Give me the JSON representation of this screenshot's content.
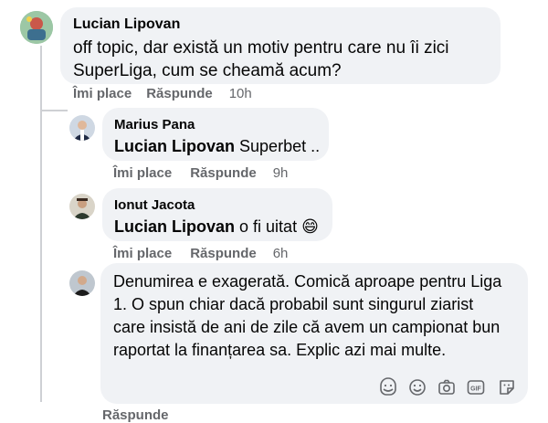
{
  "comments": [
    {
      "author": "Lucian Lipovan",
      "text": "off topic, dar există un motiv pentru care nu îi zici SuperLiga, cum se cheamă acum?",
      "line1": "off topic, dar există un motiv pentru care nu îi zici",
      "line2": "SuperLiga, cum se cheamă acum?",
      "like": "Îmi place",
      "reply": "Răspunde",
      "time": "10h"
    },
    {
      "author": "Marius Pana",
      "mention": "Lucian Lipovan",
      "text": "Superbet ..",
      "like": "Îmi place",
      "reply": "Răspunde",
      "time": "9h"
    },
    {
      "author": "Ionut Jacota",
      "mention": "Lucian Lipovan",
      "text": "o fi uitat 😄",
      "like": "Îmi place",
      "reply": "Răspunde",
      "time": "6h"
    }
  ],
  "reply_box": {
    "lines": [
      "Denumirea e exagerată. Comică aproape pentru Liga",
      "1. O spun chiar dacă probabil sunt singurul ziarist",
      "care insistă de ani de zile că avem un campionat bun",
      "raportat la finanțarea sa. Explic azi mai multe."
    ],
    "tools": [
      "sticker-face-icon",
      "emoji-icon",
      "camera-icon",
      "gif-icon",
      "sticker-icon"
    ],
    "gif_label": "GIF"
  },
  "footer_partial": "Răspunde",
  "colors": {
    "bubble": "#f0f2f5",
    "meta": "#65676b",
    "text": "#050505"
  }
}
